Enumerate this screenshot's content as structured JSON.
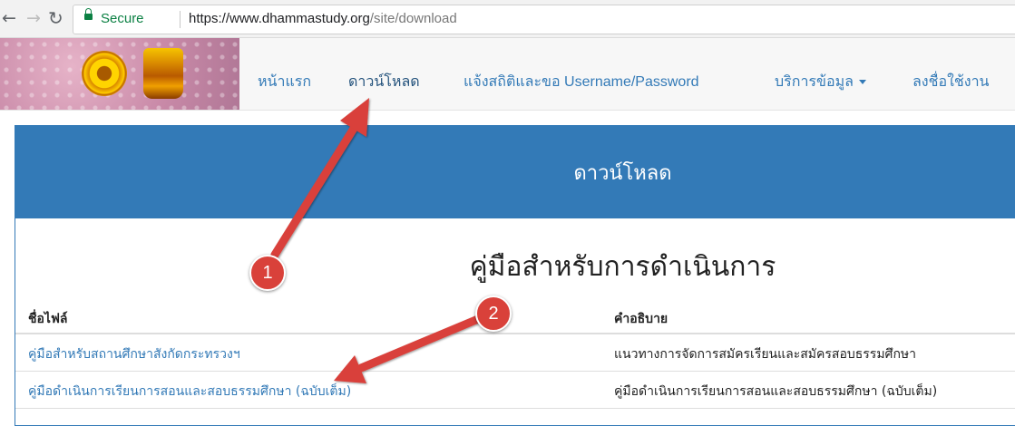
{
  "browser": {
    "secure_label": "Secure",
    "url_main": "https://www.dhammastudy.org",
    "url_path": "/site/download"
  },
  "navbar": {
    "links": [
      {
        "label": "หน้าแรก"
      },
      {
        "label": "ดาวน์โหลด"
      },
      {
        "label": "แจ้งสถิติและขอ Username/Password"
      },
      {
        "label": "บริการข้อมูล"
      },
      {
        "label": "ลงชื่อใช้งาน"
      }
    ]
  },
  "panel": {
    "heading": "ดาวน์โหลด",
    "section_title": "คู่มือสำหรับการดำเนินการ",
    "table": {
      "columns": [
        "ชื่อไฟล์",
        "คำอธิบาย"
      ],
      "rows": [
        {
          "name": "คู่มือสำหรับสถานศึกษาสังกัดกระทรวงฯ",
          "desc": "แนวทางการจัดการสมัครเรียนและสมัครสอบธรรมศึกษา"
        },
        {
          "name": "คู่มือดำเนินการเรียนการสอนและสอบธรรมศึกษา (ฉบับเต็ม)",
          "desc": "คู่มือดำเนินการเรียนการสอนและสอบธรรมศึกษา (ฉบับเต็ม)"
        }
      ]
    }
  },
  "annotations": {
    "badge_1": "1",
    "badge_2": "2",
    "color": "#d9413a"
  }
}
